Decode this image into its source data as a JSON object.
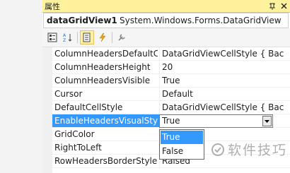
{
  "title_bar": {
    "title": "属性",
    "icons": [
      "pin-icon",
      "close-icon"
    ]
  },
  "object_selector": {
    "name": "dataGridView1",
    "type": "System.Windows.Forms.DataGridView"
  },
  "toolbar": {
    "buttons": [
      "categorized-icon",
      "alphabetical-icon",
      "properties-icon",
      "events-icon",
      "property-pages-icon"
    ]
  },
  "properties": [
    {
      "name": "ColumnHeadersDefaultCe",
      "value": "DataGridViewCellStyle { Bac"
    },
    {
      "name": "ColumnHeadersHeight",
      "value": "20"
    },
    {
      "name": "ColumnHeadersVisible",
      "value": "True"
    },
    {
      "name": "Cursor",
      "value": "Default"
    },
    {
      "name": "DefaultCellStyle",
      "value": "DataGridViewCellStyle { Bac"
    },
    {
      "name": "EnableHeadersVisualStyle",
      "value": "True"
    },
    {
      "name": "GridColor",
      "value": ""
    },
    {
      "name": "RightToLeft",
      "value": ""
    },
    {
      "name": "RowHeadersBorderStyle",
      "value": "Raised"
    }
  ],
  "dropdown": {
    "options": [
      "True",
      "False"
    ],
    "selected": "True"
  },
  "watermark": {
    "text": "软件技巧"
  },
  "colors": {
    "title_bar": "#fff29d",
    "selection": "#3399ff"
  }
}
